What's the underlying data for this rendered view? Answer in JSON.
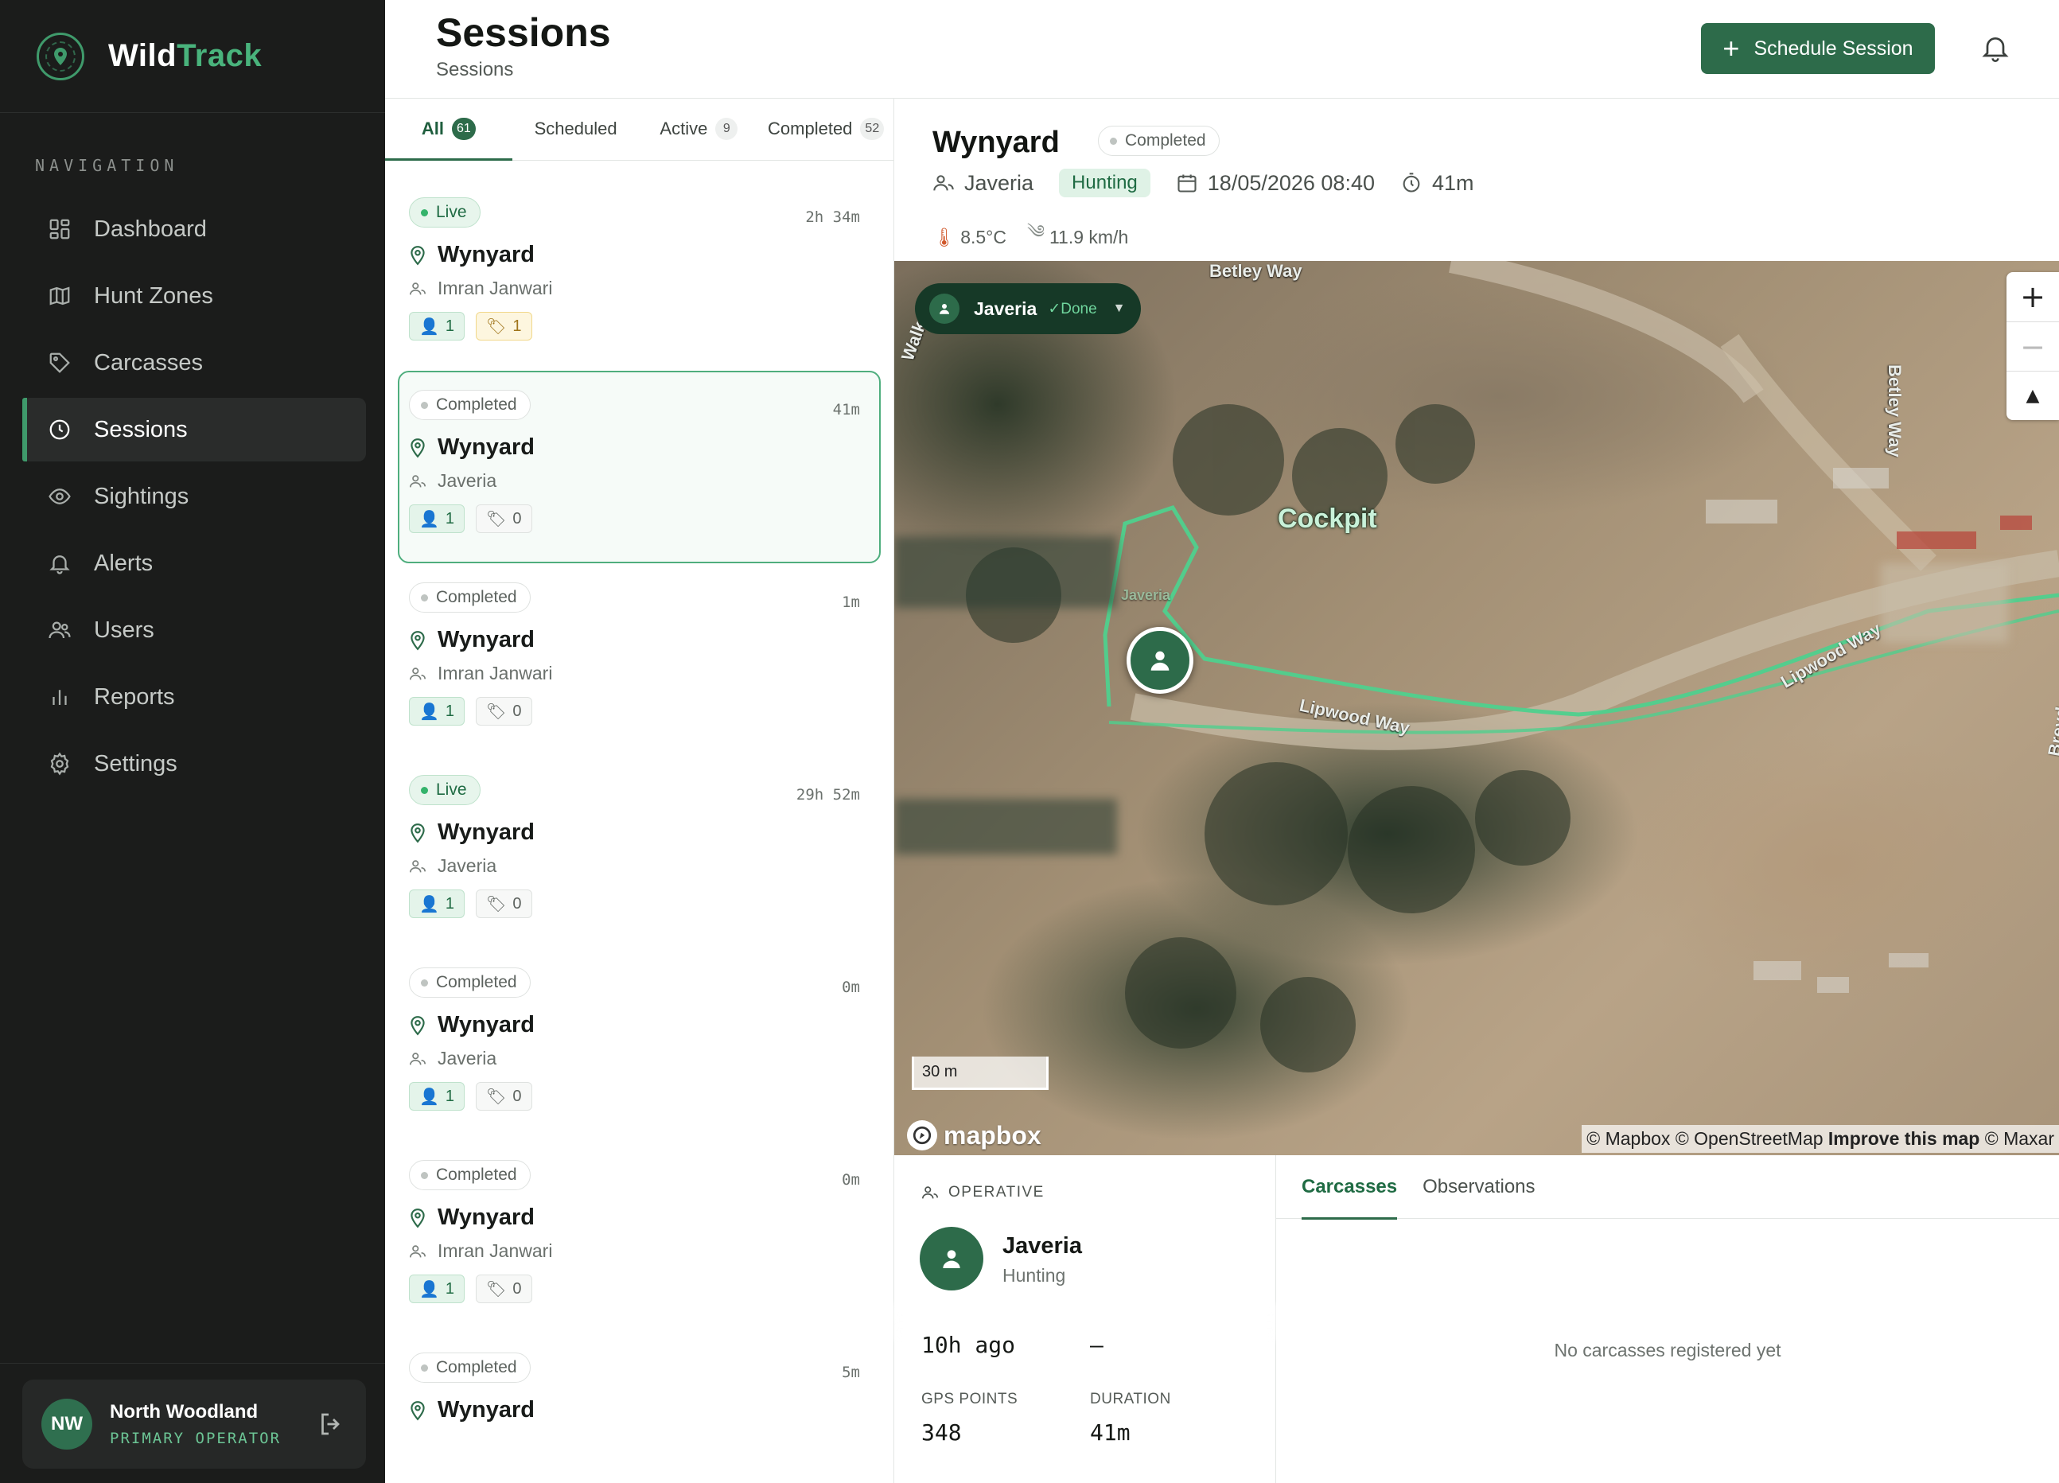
{
  "app": {
    "brand_first": "Wild",
    "brand_second": "Track"
  },
  "sidebar": {
    "nav_heading": "NAVIGATION",
    "items": [
      {
        "label": "Dashboard",
        "icon": "grid-icon"
      },
      {
        "label": "Hunt Zones",
        "icon": "map-icon"
      },
      {
        "label": "Carcasses",
        "icon": "tag-icon"
      },
      {
        "label": "Sessions",
        "icon": "clock-icon",
        "active": true
      },
      {
        "label": "Sightings",
        "icon": "eye-icon"
      },
      {
        "label": "Alerts",
        "icon": "bell-icon"
      },
      {
        "label": "Users",
        "icon": "users-icon"
      },
      {
        "label": "Reports",
        "icon": "bar-chart-icon"
      },
      {
        "label": "Settings",
        "icon": "gear-icon"
      }
    ],
    "user": {
      "initials": "NW",
      "name": "North Woodland",
      "role": "PRIMARY OPERATOR"
    }
  },
  "header": {
    "title": "Sessions",
    "subtitle": "Sessions",
    "schedule_label": "Schedule Session"
  },
  "list": {
    "tabs": [
      {
        "label": "All",
        "count": "61",
        "active": true
      },
      {
        "label": "Scheduled",
        "count": ""
      },
      {
        "label": "Active",
        "count": "9"
      },
      {
        "label": "Completed",
        "count": "52"
      }
    ],
    "sessions": [
      {
        "status": "Live",
        "elapsed": "2h 34m",
        "location": "Wynyard",
        "operative": "Imran Janwari",
        "people": "1",
        "tags": "1",
        "tag_style": "amber"
      },
      {
        "status": "Completed",
        "elapsed": "41m",
        "location": "Wynyard",
        "operative": "Javeria",
        "people": "1",
        "tags": "0",
        "selected": true
      },
      {
        "status": "Completed",
        "elapsed": "1m",
        "location": "Wynyard",
        "operative": "Imran Janwari",
        "people": "1",
        "tags": "0"
      },
      {
        "status": "Live",
        "elapsed": "29h 52m",
        "location": "Wynyard",
        "operative": "Javeria",
        "people": "1",
        "tags": "0"
      },
      {
        "status": "Completed",
        "elapsed": "0m",
        "location": "Wynyard",
        "operative": "Javeria",
        "people": "1",
        "tags": "0"
      },
      {
        "status": "Completed",
        "elapsed": "0m",
        "location": "Wynyard",
        "operative": "Imran Janwari",
        "people": "1",
        "tags": "0"
      },
      {
        "status": "Completed",
        "elapsed": "5m",
        "location": "Wynyard",
        "operative": "",
        "people": "",
        "tags": ""
      }
    ]
  },
  "detail": {
    "title": "Wynyard",
    "status": "Completed",
    "operative": "Javeria",
    "activity": "Hunting",
    "datetime": "18/05/2026 08:40",
    "duration": "41m",
    "temperature": "8.5°C",
    "wind": "11.9 km/h",
    "map": {
      "pill_name": "Javeria",
      "pill_status": "✓Done",
      "labels": {
        "cockpit": "Cockpit",
        "betley_top": "Betley Way",
        "betley_side": "Betley Way",
        "lipwood_1": "Lipwood Way",
        "lipwood_2": "Lipwood Way",
        "breydon": "Breydon Clo",
        "walk": "Walk",
        "javeria": "Javeria"
      },
      "zoom_in": "+",
      "zoom_out": "−",
      "compass": "▲",
      "scale": "30 m",
      "logo": "mapbox",
      "attribution_1": "© Mapbox © OpenStreetMap ",
      "attribution_improve": "Improve this map",
      "attribution_2": " © Maxar"
    },
    "operative_panel": {
      "label": "OPERATIVE",
      "name": "Javeria",
      "role": "Hunting",
      "partial_left": "10h ago",
      "partial_right": "—",
      "gps_label": "GPS POINTS",
      "gps_value": "348",
      "duration_label": "DURATION",
      "duration_value": "41m"
    },
    "tabs": [
      {
        "label": "Carcasses",
        "active": true
      },
      {
        "label": "Observations"
      }
    ],
    "empty_message": "No carcasses registered yet"
  },
  "colors": {
    "accent": "#2d6b4a",
    "live": "#34b36b",
    "sidebar_bg": "#1b1c1b",
    "route": "#4fd08d"
  }
}
